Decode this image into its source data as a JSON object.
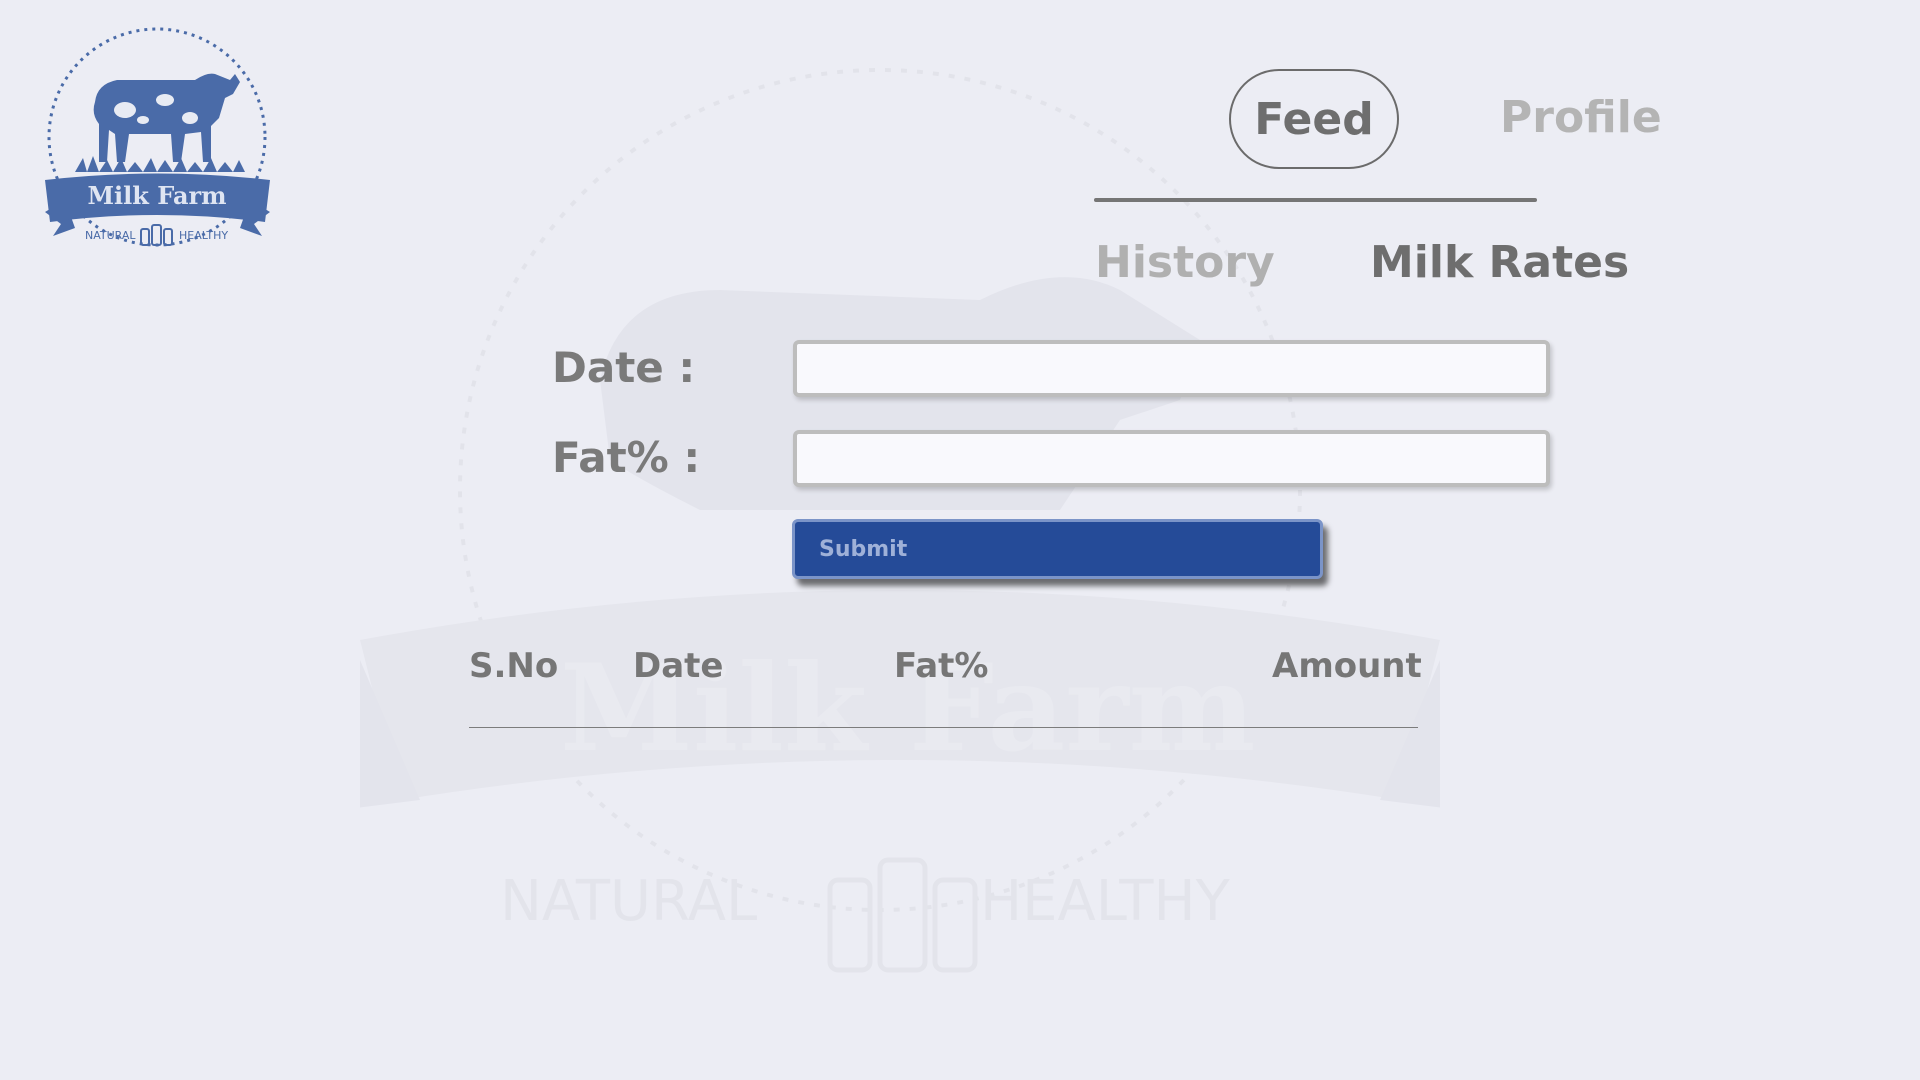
{
  "logo": {
    "brand": "Milk Farm",
    "left_tag": "NATURAL",
    "right_tag": "HEALTHY",
    "icon": "cow-logo-icon"
  },
  "nav": {
    "tabs": [
      {
        "label": "Feed",
        "active": true
      },
      {
        "label": "Profile",
        "active": false
      }
    ]
  },
  "subnav": {
    "tabs": [
      {
        "label": "History",
        "active": false
      },
      {
        "label": "Milk Rates",
        "active": true
      }
    ]
  },
  "form": {
    "date_label": "Date :",
    "date_value": "",
    "fat_label": "Fat% :",
    "fat_value": "",
    "submit_label": "Submit"
  },
  "table": {
    "headers": [
      "S.No",
      "Date",
      "Fat%",
      "Amount"
    ],
    "rows": []
  },
  "colors": {
    "background": "#ecedf4",
    "accent": "#254b98",
    "logo_blue": "#4a6ba8",
    "text_dark": "#6e6e6e",
    "text_light": "#b4b4b4"
  }
}
